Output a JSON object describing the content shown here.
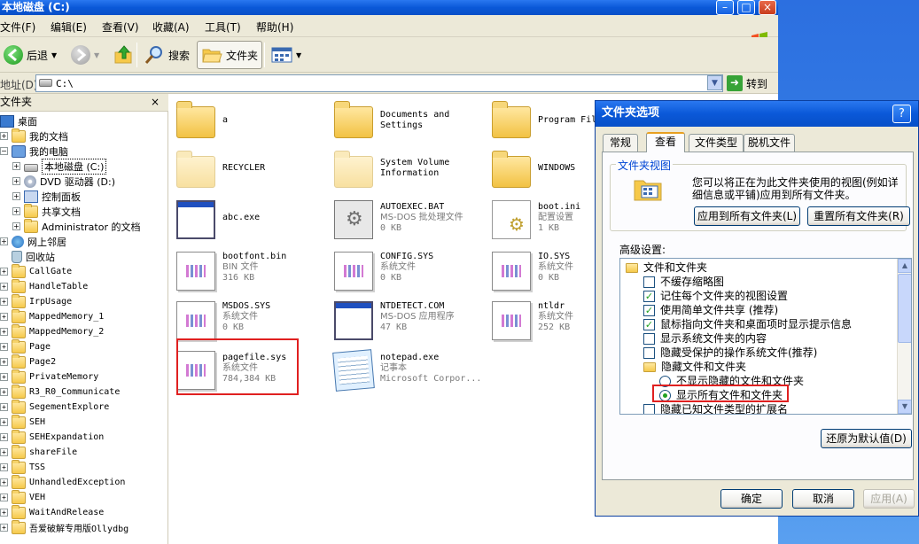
{
  "window": {
    "title": "本地磁盘 (C:)"
  },
  "menu": [
    "文件(F)",
    "编辑(E)",
    "查看(V)",
    "收藏(A)",
    "工具(T)",
    "帮助(H)"
  ],
  "toolbar": {
    "back": "后退",
    "search": "搜索",
    "folders": "文件夹"
  },
  "address": {
    "label": "地址(D)",
    "value": "C:\\",
    "go": "转到"
  },
  "tree": {
    "header": "文件夹",
    "close": "×",
    "items": [
      "桌面",
      "我的文档",
      "我的电脑",
      "本地磁盘 (C:)",
      "DVD 驱动器 (D:)",
      "控制面板",
      "共享文档",
      "Administrator 的文档",
      "网上邻居",
      "回收站",
      "CallGate",
      "HandleTable",
      "IrpUsage",
      "MappedMemory_1",
      "MappedMemory_2",
      "Page",
      "Page2",
      "PrivateMemory",
      "R3_R0_Communicate",
      "SegementExplore",
      "SEH",
      "SEHExpandation",
      "shareFile",
      "TSS",
      "UnhandledException",
      "VEH",
      "WaitAndRelease",
      "吾爱破解专用版Ollydbg"
    ]
  },
  "files": [
    {
      "name": "a",
      "l1": "",
      "l2": ""
    },
    {
      "name": "Documents and",
      "l1": "Settings",
      "l2": ""
    },
    {
      "name": "Program Fil",
      "l1": "",
      "l2": ""
    },
    {
      "name": "RECYCLER",
      "l1": "",
      "l2": ""
    },
    {
      "name": "System Volume",
      "l1": "Information",
      "l2": ""
    },
    {
      "name": "WINDOWS",
      "l1": "",
      "l2": ""
    },
    {
      "name": "abc.exe",
      "l1": "",
      "l2": ""
    },
    {
      "name": "AUTOEXEC.BAT",
      "l1": "MS-DOS 批处理文件",
      "l2": "0 KB"
    },
    {
      "name": "boot.ini",
      "l1": "配置设置",
      "l2": "1 KB"
    },
    {
      "name": "bootfont.bin",
      "l1": "BIN 文件",
      "l2": "316 KB"
    },
    {
      "name": "CONFIG.SYS",
      "l1": "系统文件",
      "l2": "0 KB"
    },
    {
      "name": "IO.SYS",
      "l1": "系统文件",
      "l2": "0 KB"
    },
    {
      "name": "MSDOS.SYS",
      "l1": "系统文件",
      "l2": "0 KB"
    },
    {
      "name": "NTDETECT.COM",
      "l1": "MS-DOS 应用程序",
      "l2": "47 KB"
    },
    {
      "name": "ntldr",
      "l1": "系统文件",
      "l2": "252 KB"
    },
    {
      "name": "pagefile.sys",
      "l1": "系统文件",
      "l2": "784,384 KB"
    },
    {
      "name": "notepad.exe",
      "l1": "记事本",
      "l2": "Microsoft Corpor..."
    }
  ],
  "dialog": {
    "title": "文件夹选项",
    "help": "?",
    "tabs": [
      "常规",
      "查看",
      "文件类型",
      "脱机文件"
    ],
    "group_label": "文件夹视图",
    "group_text": "您可以将正在为此文件夹使用的视图(例如详细信息或平铺)应用到所有文件夹。",
    "apply_all": "应用到所有文件夹(L)",
    "reset_all": "重置所有文件夹(R)",
    "advanced_label": "高级设置:",
    "advanced": [
      "文件和文件夹",
      "不缓存缩略图",
      "记住每个文件夹的视图设置",
      "使用简单文件共享 (推荐)",
      "鼠标指向文件夹和桌面项时显示提示信息",
      "显示系统文件夹的内容",
      "隐藏受保护的操作系统文件(推荐)",
      "隐藏文件和文件夹",
      "不显示隐藏的文件和文件夹",
      "显示所有文件和文件夹",
      "隐藏已知文件类型的扩展名"
    ],
    "restore": "还原为默认值(D)",
    "ok": "确定",
    "cancel": "取消",
    "apply": "应用(A)"
  }
}
